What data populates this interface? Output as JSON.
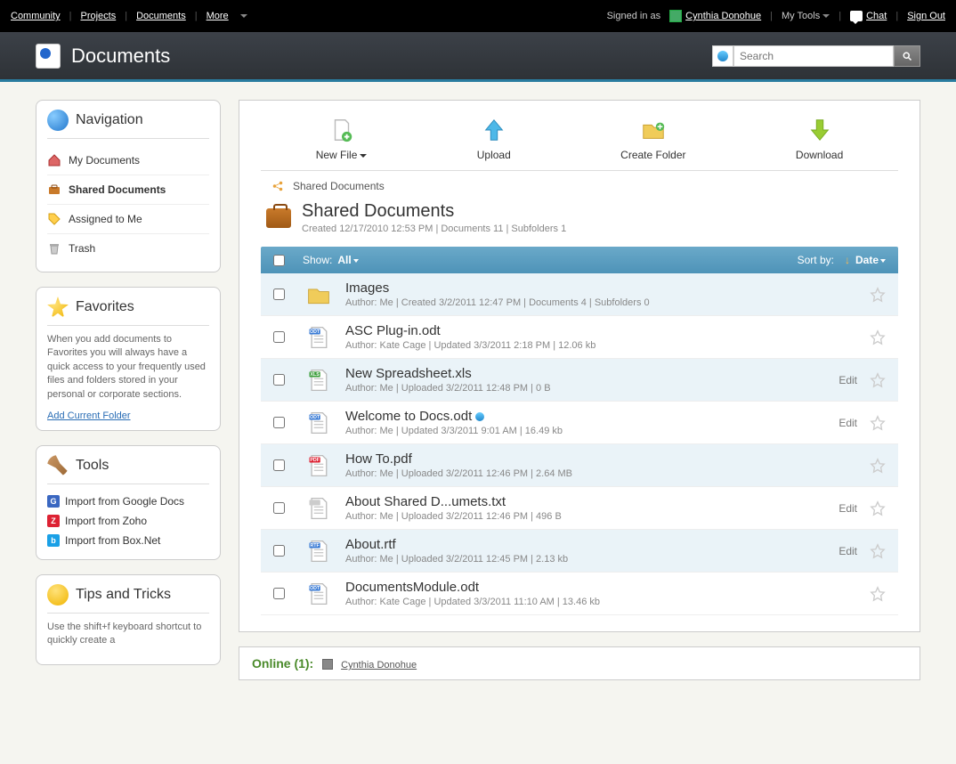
{
  "topbar": {
    "left": [
      "Community",
      "Projects",
      "Documents",
      "More"
    ],
    "signed_in_as": "Signed in as",
    "user_name": "Cynthia Donohue",
    "my_tools": "My Tools",
    "chat": "Chat",
    "sign_out": "Sign Out"
  },
  "header": {
    "title": "Documents",
    "search_placeholder": "Search"
  },
  "nav_panel": {
    "title": "Navigation",
    "items": [
      {
        "label": "My Documents",
        "icon": "home",
        "active": false
      },
      {
        "label": "Shared Documents",
        "icon": "briefcase",
        "active": true
      },
      {
        "label": "Assigned to Me",
        "icon": "tag",
        "active": false
      },
      {
        "label": "Trash",
        "icon": "trash",
        "active": false
      }
    ]
  },
  "fav_panel": {
    "title": "Favorites",
    "text": "When you add documents to Favorites you will always have a quick access to your frequently used files and folders stored in your personal or corporate sections.",
    "link": "Add Current Folder"
  },
  "tools_panel": {
    "title": "Tools",
    "items": [
      {
        "label": "Import from Google Docs",
        "badge": "G",
        "color": "#3a67c1"
      },
      {
        "label": "Import from Zoho",
        "badge": "Z",
        "color": "#d23"
      },
      {
        "label": "Import from Box.Net",
        "badge": "b",
        "color": "#1aa0e6"
      }
    ]
  },
  "tips_panel": {
    "title": "Tips and Tricks",
    "text": "Use the shift+f keyboard shortcut to quickly create a"
  },
  "toolbar": {
    "items": [
      {
        "label": "New File",
        "icon": "newfile",
        "caret": true
      },
      {
        "label": "Upload",
        "icon": "upload",
        "caret": false
      },
      {
        "label": "Create Folder",
        "icon": "newfolder",
        "caret": false
      },
      {
        "label": "Download",
        "icon": "download",
        "caret": false
      }
    ]
  },
  "crumb": {
    "label": "Shared Documents"
  },
  "hero": {
    "title": "Shared Documents",
    "sub": "Created 12/17/2010 12:53 PM | Documents 11 | Subfolders 1"
  },
  "list_header": {
    "show_label": "Show:",
    "show_value": "All",
    "sort_label": "Sort by:",
    "sort_value": "Date"
  },
  "rows": [
    {
      "name": "Images",
      "meta": "Author: Me | Created 3/2/2011 12:47 PM | Documents 4 | Subfolders 0",
      "type": "folder",
      "alt": true,
      "edit": null,
      "new": false
    },
    {
      "name": "ASC Plug-in.odt",
      "meta": "Author: Kate Cage | Updated 3/3/2011 2:18 PM | 12.06 kb",
      "type": "odt",
      "alt": false,
      "edit": null,
      "new": false
    },
    {
      "name": "New Spreadsheet.xls",
      "meta": "Author: Me | Uploaded 3/2/2011 12:48 PM | 0 B",
      "type": "xls",
      "alt": true,
      "edit": "Edit",
      "new": false
    },
    {
      "name": "Welcome to Docs.odt",
      "meta": "Author: Me | Updated 3/3/2011 9:01 AM | 16.49 kb",
      "type": "odt",
      "alt": false,
      "edit": "Edit",
      "new": true
    },
    {
      "name": "How To.pdf",
      "meta": "Author: Me | Uploaded 3/2/2011 12:46 PM | 2.64 MB",
      "type": "pdf",
      "alt": true,
      "edit": null,
      "new": false
    },
    {
      "name": "About Shared D...umets.txt",
      "meta": "Author: Me | Uploaded 3/2/2011 12:46 PM | 496 B",
      "type": "txt",
      "alt": false,
      "edit": "Edit",
      "new": false
    },
    {
      "name": "About.rtf",
      "meta": "Author: Me | Uploaded 3/2/2011 12:45 PM | 2.13 kb",
      "type": "rtf",
      "alt": true,
      "edit": "Edit",
      "new": false
    },
    {
      "name": "DocumentsModule.odt",
      "meta": "Author: Kate Cage | Updated 3/3/2011 11:10 AM | 13.46 kb",
      "type": "odt",
      "alt": false,
      "edit": null,
      "new": false
    }
  ],
  "online": {
    "label": "Online (1):",
    "user": "Cynthia Donohue"
  },
  "file_badges": {
    "odt": {
      "text": "ODT",
      "color": "#3a7bd5"
    },
    "xls": {
      "text": "XLS",
      "color": "#3a9d3a"
    },
    "pdf": {
      "text": "PDF",
      "color": "#d23"
    },
    "rtf": {
      "text": "RTF",
      "color": "#3a7bd5"
    },
    "txt": {
      "text": "",
      "color": "#ccc"
    }
  }
}
